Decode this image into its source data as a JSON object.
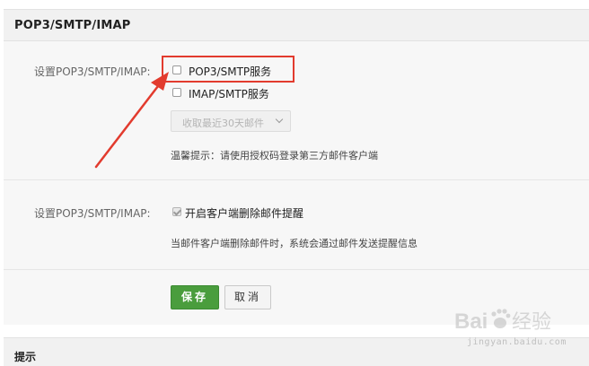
{
  "header": {
    "title": "POP3/SMTP/IMAP"
  },
  "section1": {
    "label": "设置POP3/SMTP/IMAP:",
    "option_pop3": {
      "label": "POP3/SMTP服务",
      "checked": false
    },
    "option_imap": {
      "label": "IMAP/SMTP服务",
      "checked": false
    },
    "dropdown": {
      "selected": "收取最近30天邮件",
      "disabled": true
    },
    "hint": "温馨提示：请使用授权码登录第三方邮件客户端"
  },
  "section2": {
    "label": "设置POP3/SMTP/IMAP:",
    "option_delete_remind": {
      "label": "开启客户端删除邮件提醒",
      "checked": true
    },
    "description": "当邮件客户端删除邮件时，系统会通过邮件发送提醒信息"
  },
  "actions": {
    "save_label": "保存",
    "cancel_label": "取消"
  },
  "footer": {
    "title": "提示"
  },
  "annotation": {
    "color": "#e23b2e"
  },
  "watermark": {
    "brand": "Baidu经验",
    "url": "jingyan.baidu.com"
  },
  "colors": {
    "save_button": "#4a9d3d",
    "section_background": "#f7f7f7",
    "header_background": "#f1f1f1"
  }
}
